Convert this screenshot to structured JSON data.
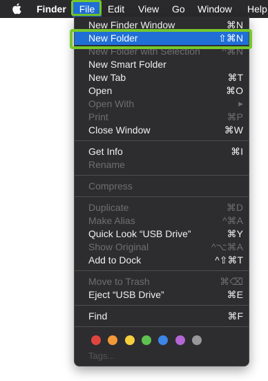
{
  "menubar": {
    "apple_icon": "",
    "app_name": "Finder",
    "menus": {
      "file": "File",
      "edit": "Edit",
      "view": "View",
      "go": "Go",
      "window": "Window",
      "help": "Help"
    }
  },
  "file_menu": {
    "items": [
      {
        "label": "New Finder Window",
        "shortcut": "⌘N",
        "enabled": true
      },
      {
        "label": "New Folder",
        "shortcut": "⇧⌘N",
        "enabled": true,
        "selected": true
      },
      {
        "label": "New Folder with Selection",
        "shortcut": "^⌘N",
        "enabled": false
      },
      {
        "label": "New Smart Folder",
        "shortcut": "",
        "enabled": true
      },
      {
        "label": "New Tab",
        "shortcut": "⌘T",
        "enabled": true
      },
      {
        "label": "Open",
        "shortcut": "⌘O",
        "enabled": true
      },
      {
        "label": "Open With",
        "shortcut": "▶",
        "enabled": false
      },
      {
        "label": "Print",
        "shortcut": "⌘P",
        "enabled": false
      },
      {
        "label": "Close Window",
        "shortcut": "⌘W",
        "enabled": true
      },
      {
        "label": "Get Info",
        "shortcut": "⌘I",
        "enabled": true
      },
      {
        "label": "Rename",
        "shortcut": "",
        "enabled": false
      },
      {
        "label": "Compress",
        "shortcut": "",
        "enabled": false
      },
      {
        "label": "Duplicate",
        "shortcut": "⌘D",
        "enabled": false
      },
      {
        "label": "Make Alias",
        "shortcut": "^⌘A",
        "enabled": false
      },
      {
        "label": "Quick Look “USB Drive”",
        "shortcut": "⌘Y",
        "enabled": true
      },
      {
        "label": "Show Original",
        "shortcut": "^⌥⌘A",
        "enabled": false
      },
      {
        "label": "Add to Dock",
        "shortcut": "^⇧⌘T",
        "enabled": true
      },
      {
        "label": "Move to Trash",
        "shortcut": "⌘⌫",
        "enabled": false
      },
      {
        "label": "Eject “USB Drive”",
        "shortcut": "⌘E",
        "enabled": true
      },
      {
        "label": "Find",
        "shortcut": "⌘F",
        "enabled": true
      }
    ],
    "tags_label": "Tags...",
    "tag_colors": [
      {
        "name": "red-tag",
        "color": "#e0443e"
      },
      {
        "name": "orange-tag",
        "color": "#f29a38"
      },
      {
        "name": "yellow-tag",
        "color": "#f5cf3e"
      },
      {
        "name": "green-tag",
        "color": "#5dc24f"
      },
      {
        "name": "blue-tag",
        "color": "#3d86e8"
      },
      {
        "name": "purple-tag",
        "color": "#b466d6"
      },
      {
        "name": "gray-tag",
        "color": "#98989b"
      }
    ]
  },
  "colors": {
    "highlight_outline": "#76c82a",
    "selection": "#1f6fd6",
    "menu_background": "#2d2d2f"
  }
}
